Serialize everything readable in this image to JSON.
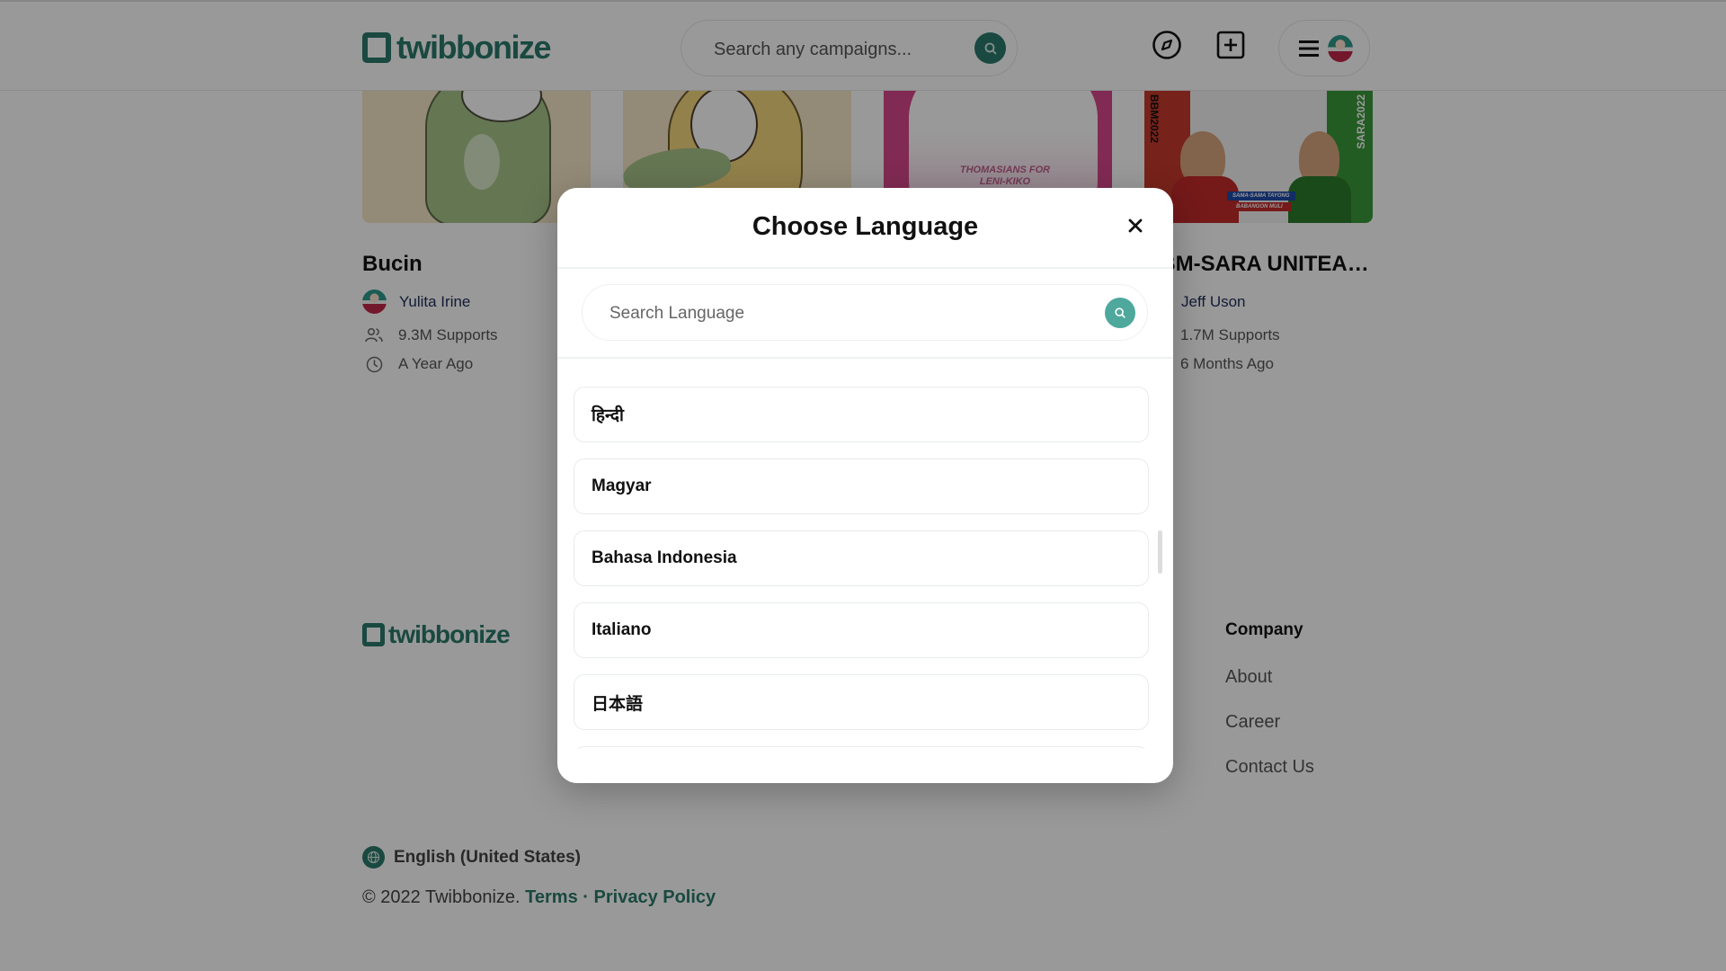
{
  "header": {
    "brand": "twibbonize",
    "search_placeholder": "Search any campaigns...",
    "icons": [
      "compass-icon",
      "add-square-icon",
      "menu-icon",
      "avatar"
    ]
  },
  "cards": [
    {
      "title": "Bucin",
      "author": "Yulita Irine",
      "supports": "9.3M Supports",
      "time": "A Year Ago",
      "image": "green dinosaur frame"
    },
    {
      "title": "",
      "image": "yellow dinosaur frame"
    },
    {
      "title": "",
      "image": "pink Thomasians for Leni-Kiko frame",
      "image_text": "THOMASIANS FOR LENI-KIKO"
    },
    {
      "title": "BBM-SARA UNITEAM...",
      "title_visible": "M-SARA UNITEAM...",
      "author": "Jeff Uson",
      "supports": "1.7M Supports",
      "time": "6 Months Ago",
      "image": "BBM 2022 / SARA 2022 frame",
      "image_text_left": "BBM2022",
      "image_text_right": "SARA2022",
      "image_banner_1": "SAMA-SAMA TAYONG",
      "image_banner_2": "BABANGON MULI"
    }
  ],
  "footer": {
    "brand": "twibbonize",
    "company_heading": "Company",
    "company_links": [
      "About",
      "Career",
      "Contact Us"
    ],
    "current_language": "English (United States)",
    "copyright": "© 2022 Twibbonize.",
    "terms": "Terms",
    "separator": "·",
    "privacy": "Privacy Policy"
  },
  "modal": {
    "title": "Choose Language",
    "search_placeholder": "Search Language",
    "languages": [
      "हिन्दी",
      "Magyar",
      "Bahasa Indonesia",
      "Italiano",
      "日本語",
      ""
    ],
    "scroll_position": 0.45
  },
  "colors": {
    "brand": "#2b7a6b",
    "modal_search_button": "#4ea89c",
    "overlay": "rgba(0,0,0,0.40)"
  }
}
